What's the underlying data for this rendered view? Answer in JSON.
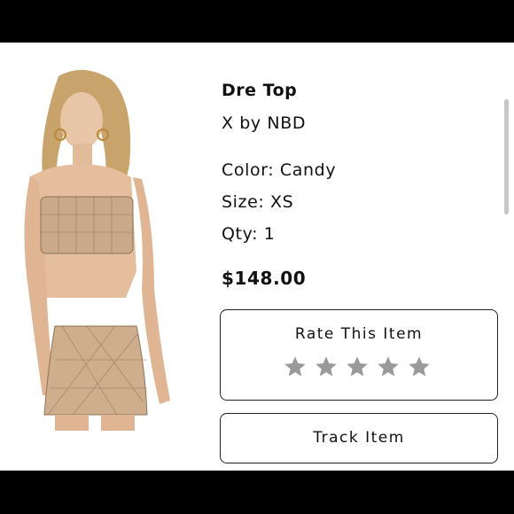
{
  "product": {
    "title": "Dre Top",
    "brand": "X by NBD",
    "color": "Color: Candy",
    "size": "Size: XS",
    "qty": "Qty: 1",
    "price": "$148.00",
    "image_icon": "product-photo"
  },
  "rating": {
    "label": "Rate This Item",
    "stars_total": 5,
    "stars_filled": 0,
    "star_color": "#9a9a9a",
    "star_icon": "star-icon"
  },
  "track": {
    "label": "Track Item"
  },
  "colors": {
    "background": "#ffffff",
    "frame": "#000000",
    "text": "#111111"
  }
}
